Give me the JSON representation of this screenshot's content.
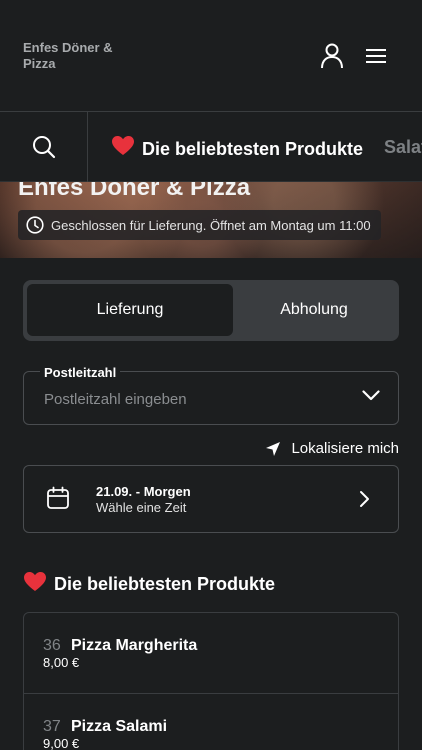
{
  "header": {
    "brand": "Enfes Döner & Pizza",
    "icons": {
      "account": "user-icon",
      "menu": "hamburger-menu-icon"
    }
  },
  "category_bar": {
    "search_icon": "search-icon",
    "categories": [
      {
        "label": "Die beliebtesten Produkte",
        "emoji": "❤️",
        "active": true
      },
      {
        "label": "Salat",
        "active": false
      }
    ]
  },
  "hero": {
    "title": "Enfes Döner & Pizza",
    "status": "Geschlossen für Lieferung. Öffnet am Montag um 11:00"
  },
  "order_type": {
    "options": [
      "Lieferung",
      "Abholung"
    ],
    "selected": "Lieferung"
  },
  "postcode": {
    "label": "Postleitzahl",
    "placeholder": "Postleitzahl eingeben",
    "value": ""
  },
  "locate": {
    "label": "Lokalisiere mich"
  },
  "time_select": {
    "date": "21.09. - Morgen",
    "hint": "Wähle eine Zeit"
  },
  "popular": {
    "emoji": "❤️",
    "title": "Die beliebtesten Produkte",
    "products": [
      {
        "number": "36",
        "name": "Pizza Margherita",
        "price": "8,00 €"
      },
      {
        "number": "37",
        "name": "Pizza Salami",
        "price": "9,00 €"
      }
    ]
  },
  "colors": {
    "background": "#1c1e1f",
    "heart": "#e8323c",
    "muted_text": "#7d8184",
    "toggle_track": "#3a3d40",
    "border": "#4a4d50"
  }
}
